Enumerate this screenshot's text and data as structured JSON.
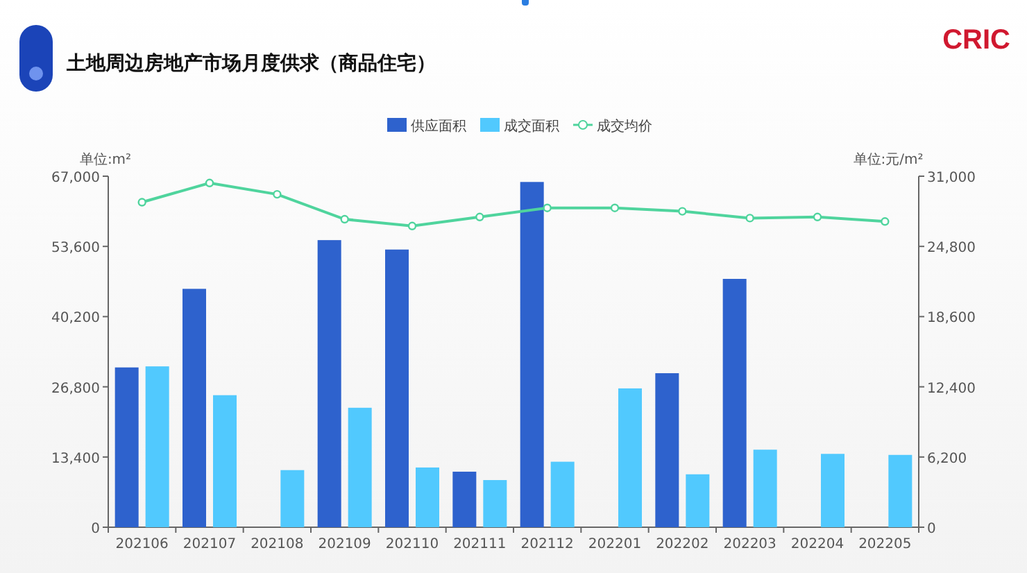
{
  "header": {
    "title": "土地周边房地产市场月度供求（商品住宅）",
    "logo": "CRIC"
  },
  "chart": {
    "chart_data": {
      "type": "bar",
      "stacked": false,
      "legend": "top",
      "categories": [
        "202106",
        "202107",
        "202108",
        "202109",
        "202110",
        "202111",
        "202112",
        "202201",
        "202202",
        "202203",
        "202204",
        "202205"
      ],
      "series": [
        {
          "name": "供应面积",
          "color": "#2e62cd",
          "values": [
            30500,
            45500,
            null,
            54800,
            53000,
            10600,
            65900,
            null,
            29400,
            47400,
            null,
            null
          ]
        },
        {
          "name": "成交面积",
          "color": "#51c9fe",
          "values": [
            30700,
            25200,
            10900,
            22800,
            11400,
            9000,
            12500,
            26500,
            10100,
            14800,
            14000,
            13800
          ]
        },
        {
          "name": "成交均价",
          "color": "#4fd49d",
          "type": "line",
          "axis": "y2",
          "marker": "circle",
          "values": [
            28700,
            30400,
            29400,
            27200,
            26600,
            27400,
            28200,
            28200,
            27900,
            27300,
            27400,
            27000
          ]
        }
      ],
      "ylabel": "单位:m²",
      "y2label": "单位:元/m²",
      "ylim": [
        0,
        67000
      ],
      "yticks": [
        {
          "value": 0,
          "label": "0"
        },
        {
          "value": 13400,
          "label": "13,400"
        },
        {
          "value": 26800,
          "label": "26,800"
        },
        {
          "value": 40200,
          "label": "40,200"
        },
        {
          "value": 53600,
          "label": "53,600"
        },
        {
          "value": 67000,
          "label": "67,000"
        }
      ],
      "y2lim": [
        0,
        31000
      ],
      "y2ticks": [
        {
          "value": 0,
          "label": "0"
        },
        {
          "value": 6200,
          "label": "6,200"
        },
        {
          "value": 12400,
          "label": "12,400"
        },
        {
          "value": 18600,
          "label": "18,600"
        },
        {
          "value": 24800,
          "label": "24,800"
        },
        {
          "value": 31000,
          "label": "31,000"
        }
      ]
    }
  }
}
